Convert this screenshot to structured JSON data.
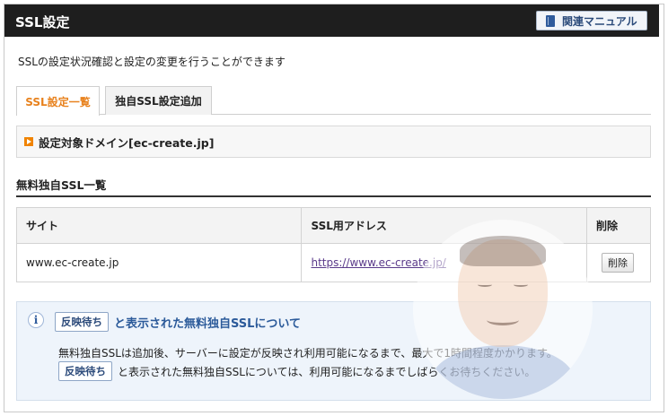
{
  "header": {
    "title": "SSL設定",
    "manual_button": "関連マニュアル",
    "manual_icon": "book-icon"
  },
  "description": "SSLの設定状況確認と設定の変更を行うことができます",
  "tabs": [
    {
      "label": "SSL設定一覧",
      "active": true
    },
    {
      "label": "独自SSL設定追加",
      "active": false
    }
  ],
  "target_domain": {
    "label": "設定対象ドメイン[ec-create.jp]",
    "marker_color": "#f08300"
  },
  "section_title": "無料独自SSL一覧",
  "table": {
    "headers": [
      "サイト",
      "SSL用アドレス",
      "削除"
    ],
    "rows": [
      {
        "site": "www.ec-create.jp",
        "address": "https://www.ec-create.jp/",
        "delete_label": "削除"
      }
    ]
  },
  "info": {
    "icon": "i",
    "badge": "反映待ち",
    "title": "と表示された無料独自SSLについて",
    "line1": "無料独自SSLは追加後、サーバーに設定が反映され利用可能になるまで、最大で1時間程度かかります。",
    "line2_badge": "反映待ち",
    "line2": "と表示された無料独自SSLについては、利用可能になるまでしばらくお待ちください。"
  },
  "colors": {
    "header_bg": "#1e1e1e",
    "active_tab": "#e8821e",
    "info_title": "#2b5a9a",
    "link": "#5a3a8a"
  }
}
